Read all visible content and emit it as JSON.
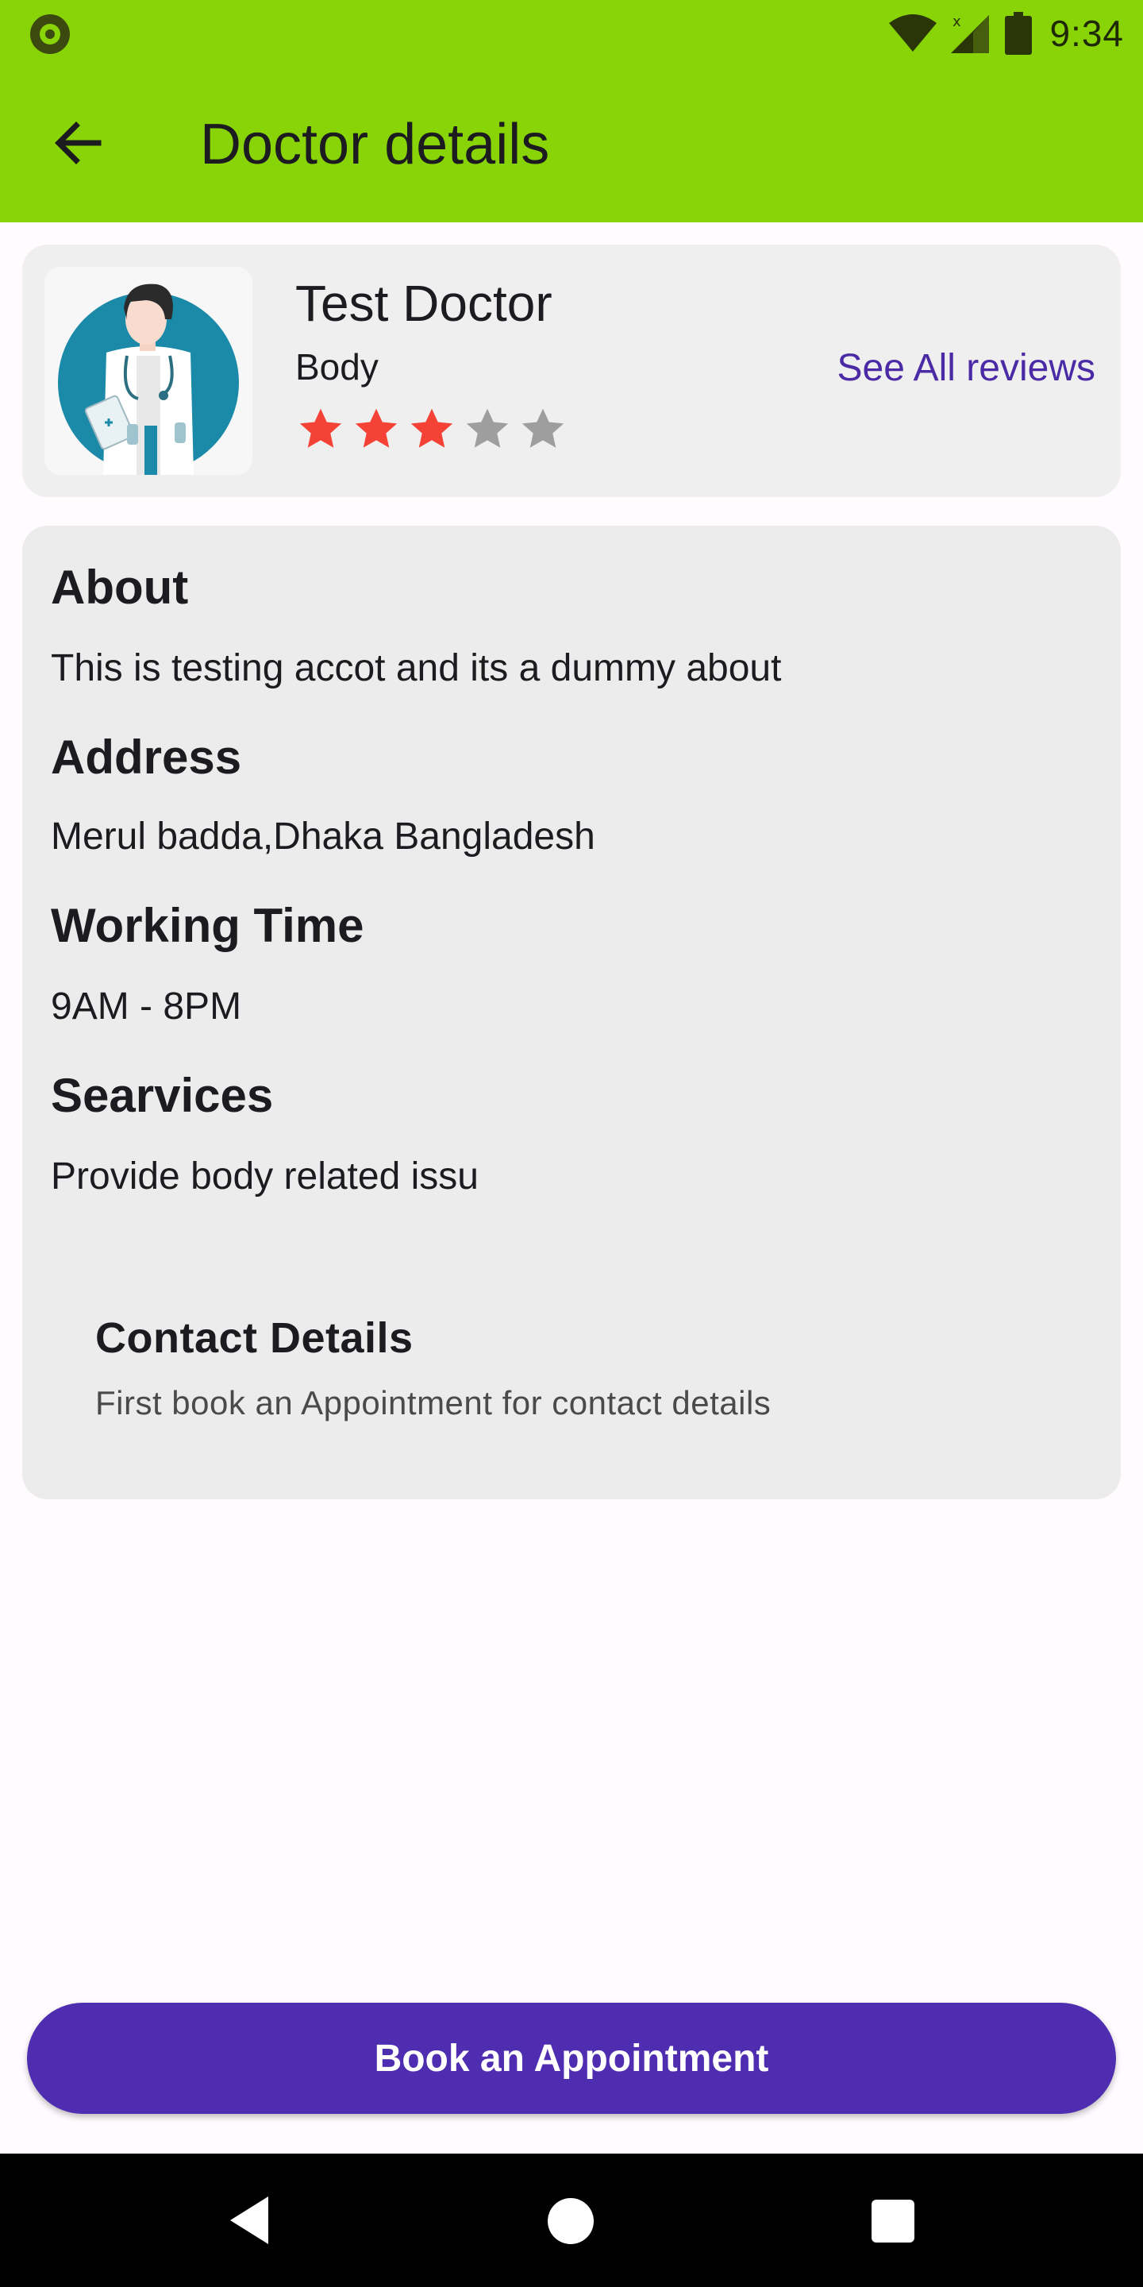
{
  "status_bar": {
    "time": "9:34",
    "icons": [
      "record-icon",
      "wifi-icon",
      "cell-signal-icon",
      "battery-icon"
    ]
  },
  "app_bar": {
    "title": "Doctor details",
    "back_icon": "arrow-left-icon"
  },
  "doctor": {
    "name": "Test Doctor",
    "specialty": "Body",
    "rating": 3,
    "rating_max": 5,
    "see_all_reviews": "See All reviews"
  },
  "details": {
    "about_heading": "About",
    "about_text": "This is testing accot and its a dummy about",
    "address_heading": "Address",
    "address_text": "Merul badda,Dhaka Bangladesh",
    "working_time_heading": "Working Time",
    "working_time_text": "9AM - 8PM",
    "services_heading": "Searvices",
    "services_text": "Provide body related issu",
    "contact_heading": "Contact Details",
    "contact_text": "First book an Appointment for contact details"
  },
  "book_button": {
    "label": "Book an Appointment"
  },
  "colors": {
    "app_bar": "#88d406",
    "primary": "#4f2db0",
    "star_filled": "#f44336",
    "star_empty": "#9e9e9e"
  }
}
